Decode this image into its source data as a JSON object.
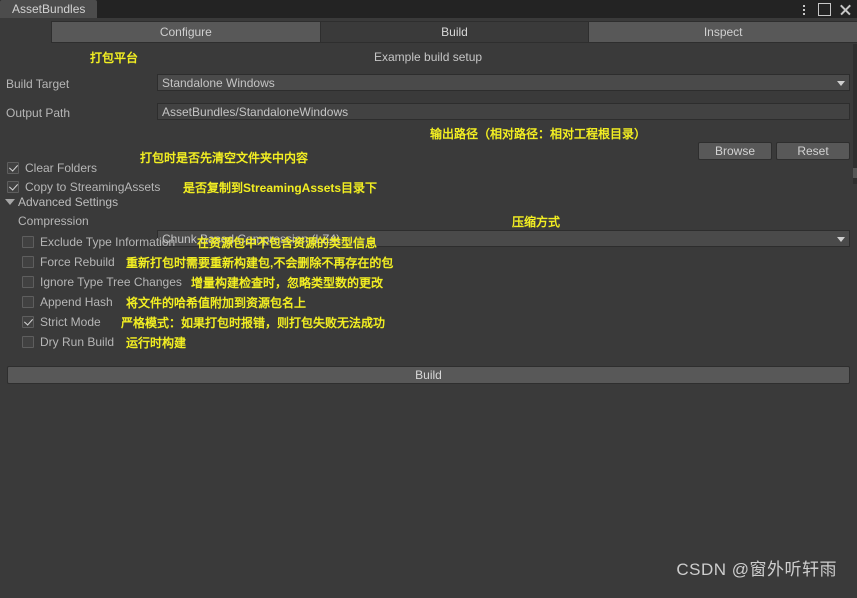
{
  "window": {
    "tab_title": "AssetBundles",
    "controls": {
      "menu": "⋮",
      "maximize": "□",
      "close": "✕"
    }
  },
  "tabs": [
    {
      "label": "Configure",
      "active": false
    },
    {
      "label": "Build",
      "active": true
    },
    {
      "label": "Inspect",
      "active": false
    }
  ],
  "header": {
    "example_label": "Example build setup",
    "platform_note": "打包平台"
  },
  "build_target": {
    "label": "Build Target",
    "value": "Standalone Windows"
  },
  "output_path": {
    "label": "Output Path",
    "value": "AssetBundles/StandaloneWindows",
    "note": "输出路径（相对路径：相对工程根目录）",
    "browse_label": "Browse",
    "reset_label": "Reset"
  },
  "options": {
    "clear_folders": {
      "label": "Clear Folders",
      "checked": true,
      "note": "打包时是否先清空文件夹中内容"
    },
    "copy_to_streaming": {
      "label": "Copy to StreamingAssets",
      "checked": true,
      "note": "是否复制到StreamingAssets目录下"
    }
  },
  "advanced": {
    "title": "Advanced Settings",
    "compression": {
      "label": "Compression",
      "value": "Chunk Based Compression (LZ4)",
      "note": "压缩方式"
    },
    "items": [
      {
        "label": "Exclude Type Information",
        "checked": false,
        "note": "在资源包中不包含资源的类型信息"
      },
      {
        "label": "Force Rebuild",
        "checked": false,
        "note": "重新打包时需要重新构建包,不会删除不再存在的包"
      },
      {
        "label": "Ignore Type Tree Changes",
        "checked": false,
        "note": "增量构建检查时，忽略类型数的更改"
      },
      {
        "label": "Append Hash",
        "checked": false,
        "note": "将文件的哈希值附加到资源包名上"
      },
      {
        "label": "Strict Mode",
        "checked": true,
        "note": "严格模式：如果打包时报错，则打包失败无法成功"
      },
      {
        "label": "Dry Run Build",
        "checked": false,
        "note": "运行时构建"
      }
    ]
  },
  "build_button": {
    "label": "Build"
  },
  "watermark": {
    "text": "CSDN @窗外听轩雨"
  },
  "colors": {
    "background": "#3a3a3a",
    "titlebar": "#232323",
    "control": "#585858",
    "field": "#424242",
    "note_yellow": "#f2ee22",
    "text": "#b6b6b6"
  }
}
